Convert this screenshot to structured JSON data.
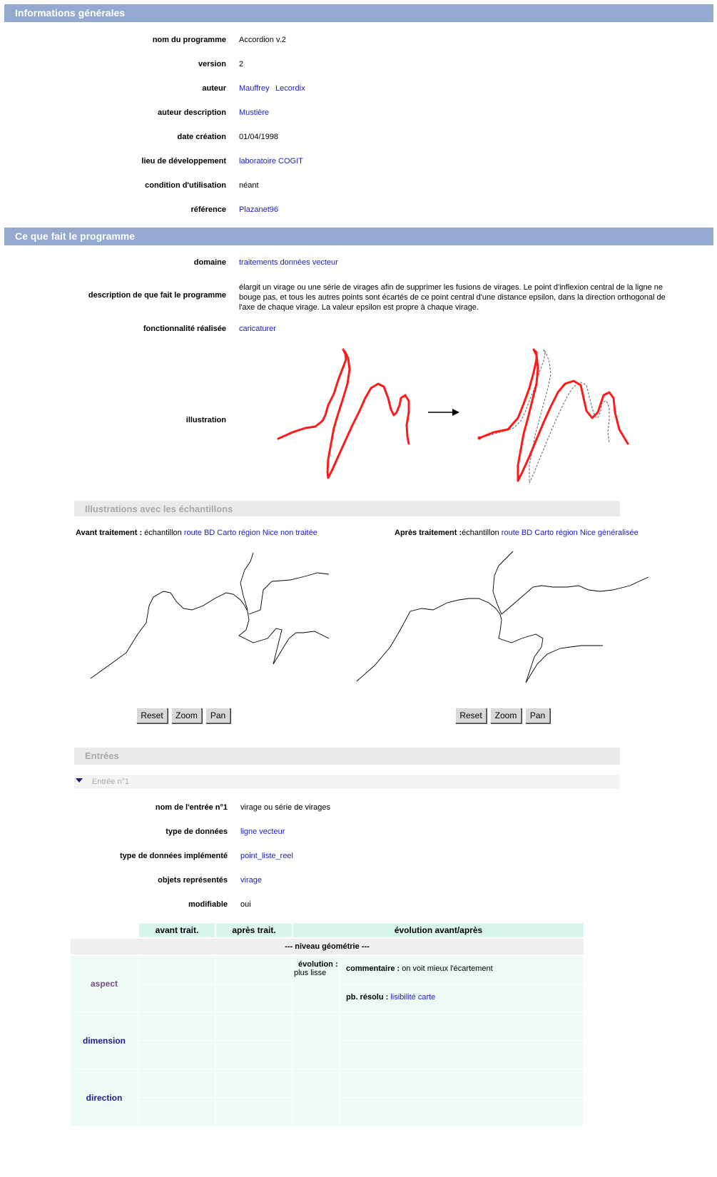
{
  "general": {
    "title": "Informations générales",
    "rows": [
      {
        "label": "nom du programme",
        "values": [
          "Accordion v.2"
        ],
        "link": false
      },
      {
        "label": "version",
        "values": [
          "2"
        ],
        "link": false
      },
      {
        "label": "auteur",
        "values": [
          "Mauffrey",
          "Lecordix"
        ],
        "link": true
      },
      {
        "label": "auteur description",
        "values": [
          "Mustière"
        ],
        "link": true
      },
      {
        "label": "date création",
        "values": [
          "01/04/1998"
        ],
        "link": false
      },
      {
        "label": "lieu de développement",
        "values": [
          "laboratoire COGIT"
        ],
        "link": true
      },
      {
        "label": "condition d'utilisation",
        "values": [
          "néant"
        ],
        "link": false
      },
      {
        "label": "référence",
        "values": [
          "Plazanet96"
        ],
        "link": true
      }
    ]
  },
  "program": {
    "title": "Ce que fait le programme",
    "domain_label": "domaine",
    "domain_value": "traitements données vecteur",
    "description_label": "description de que fait le programme",
    "description_value": "élargit un virage ou une série de virages afin de supprimer les fusions de virages. Le point d'inflexion central de la ligne ne bouge pas, et tous les autres points sont écartés de ce point central d'une distance epsilon, dans la direction orthogonal de l'axe de chaque virage. La valeur epsilon est propre à chaque virage.",
    "functionality_label": "fonctionnalité réalisée",
    "functionality_value": "caricaturer",
    "illustration_label": "illustration"
  },
  "samples": {
    "title": "Illustrations avec les échantillons",
    "before_label": "Avant traitement :",
    "before_text": " échantillon ",
    "before_link": "route BD Carto région Nice non traitée",
    "after_label": "Après traitement :",
    "after_text": "échantillon ",
    "after_link": "route BD Carto région Nice généralisée",
    "buttons": [
      "Reset",
      "Zoom",
      "Pan"
    ]
  },
  "inputs": {
    "title": "Entrées",
    "entry_title": "Entrée n°1",
    "rows": [
      {
        "label": "nom de l'entrée n°1",
        "value": "virage ou série de virages",
        "link": false
      },
      {
        "label": "type de données",
        "value": "ligne vecteur",
        "link": true
      },
      {
        "label": "type de données implémenté",
        "value": "point_liste_reel",
        "link": true
      },
      {
        "label": "objets représentés",
        "value": "virage",
        "link": true
      },
      {
        "label": "modifiable",
        "value": "oui",
        "link": false
      }
    ]
  },
  "table": {
    "headers": [
      "avant trait.",
      "après trait.",
      "évolution avant/après"
    ],
    "group_label": "--- niveau géométrie ---",
    "rows": [
      {
        "label": "aspect",
        "color": "#7b4a8c",
        "evolution_label": "évolution :",
        "evolution_value": "plus lisse",
        "comment_label": "commentaire :",
        "comment_value": " on voit mieux l'écartement",
        "resolved_label": "pb. résolu :",
        "resolved_value": " lisibilité carte"
      },
      {
        "label": "dimension",
        "color": "#1c1c9c"
      },
      {
        "label": "direction",
        "color": "#1c1c9c"
      }
    ]
  },
  "colors": {
    "header_bar": "#94a9cf",
    "link": "#1c1ccc",
    "table_header": "#d8f7ea",
    "table_body": "#eefbf5",
    "red_line": "#ff1a1a"
  }
}
